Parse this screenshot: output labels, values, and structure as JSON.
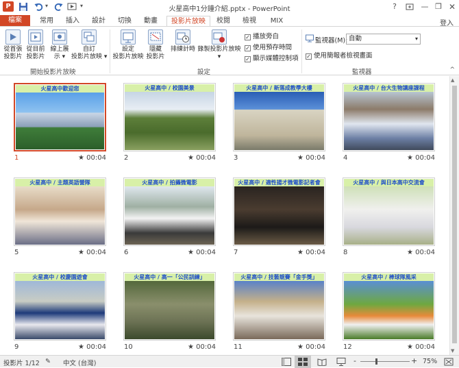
{
  "window": {
    "title": "火星高中1分鐘介紹.pptx - PowerPoint",
    "user": "登入",
    "help": "?"
  },
  "colors": {
    "accent": "#d24726",
    "caption_bg": "#d8f0a8",
    "caption_text": "#1f4fc9"
  },
  "tabs": [
    "檔案",
    "常用",
    "插入",
    "設計",
    "切換",
    "動畫",
    "投影片放映",
    "校閱",
    "檢視",
    "MIX"
  ],
  "active_tab": "投影片放映",
  "ribbon": {
    "start_group": {
      "label": "開始投影片放映",
      "buttons": [
        "從首張\n投影片",
        "從目前\n投影片",
        "線上展\n示 ▾",
        "自訂\n投影片放映 ▾"
      ]
    },
    "setup_group": {
      "label": "設定",
      "buttons": [
        "設定\n投影片放映",
        "隱藏\n投影片",
        "排練計時",
        "錄製投影片放映\n▾"
      ],
      "checks": [
        {
          "label": "播放旁白",
          "checked": true
        },
        {
          "label": "使用預存時間",
          "checked": true
        },
        {
          "label": "顯示媒體控制項",
          "checked": true
        }
      ]
    },
    "monitor_group": {
      "label": "監視器",
      "monitor_label": "監視器(M):",
      "monitor_value": "自動",
      "presenter_view": {
        "label": "使用簡報者檢視畫面",
        "checked": true
      }
    }
  },
  "slides": [
    {
      "num": "1",
      "caption": "火星高中歡迎您",
      "duration": "00:04"
    },
    {
      "num": "2",
      "caption": "火星高中 / 校園美景",
      "duration": "00:04"
    },
    {
      "num": "3",
      "caption": "火星高中 / 新落成教學大樓",
      "duration": "00:04"
    },
    {
      "num": "4",
      "caption": "火星高中 / 台大生物講座課程",
      "duration": "00:04"
    },
    {
      "num": "5",
      "caption": "火星高中 / 主題英語營隊",
      "duration": "00:04"
    },
    {
      "num": "6",
      "caption": "火星高中 / 拍攝微電影",
      "duration": "00:04"
    },
    {
      "num": "7",
      "caption": "火星高中 / 適性揚才微電影記者會",
      "duration": "00:04"
    },
    {
      "num": "8",
      "caption": "火星高中 / 與日本高中交流會",
      "duration": "00:04"
    },
    {
      "num": "9",
      "caption": "火星高中 / 校慶園遊會",
      "duration": "00:04"
    },
    {
      "num": "10",
      "caption": "火星高中 / 高一「公民訓練」",
      "duration": "00:04"
    },
    {
      "num": "11",
      "caption": "火星高中 / 技藝競賽「金手獎」",
      "duration": "00:04"
    },
    {
      "num": "12",
      "caption": "火星高中 / 棒球隊風采",
      "duration": "00:04"
    }
  ],
  "selected_slide": 1,
  "status": {
    "slide_info": "投影片 1/12",
    "language": "中文 (台灣)",
    "zoom": "75%",
    "zoom_minus": "-",
    "zoom_plus": "+"
  }
}
